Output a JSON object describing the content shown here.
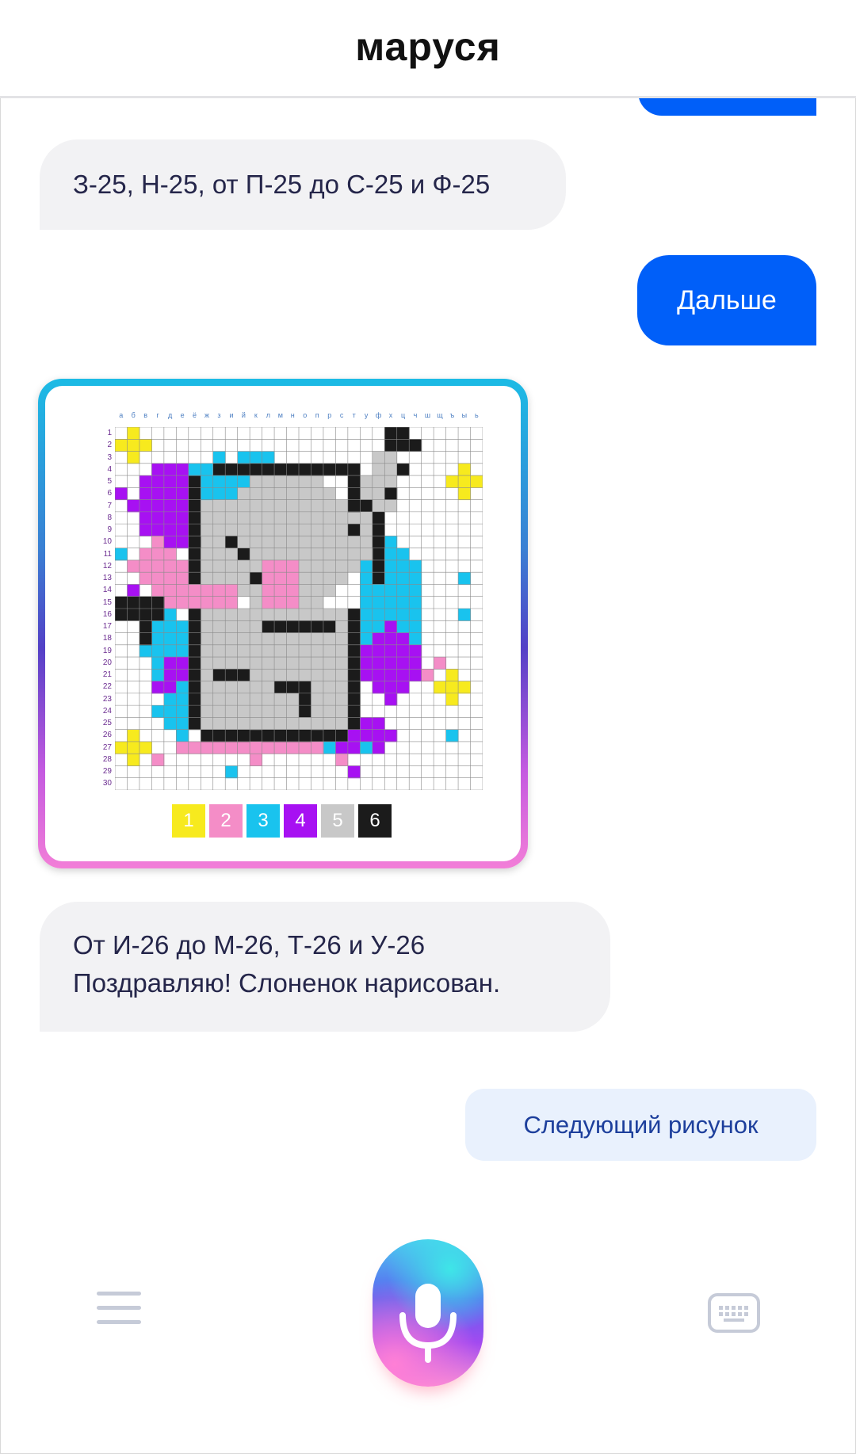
{
  "header": {
    "title": "маруся"
  },
  "chat": {
    "messages": [
      {
        "side": "assistant",
        "text": "З-25, Н-25, от П-25 до С-25 и Ф-25"
      },
      {
        "side": "user",
        "text": "Дальше"
      },
      {
        "side": "assistant",
        "lines": [
          "От И-26 до М-26, Т-26 и У-26",
          "Поздравляю! Слоненок нарисован."
        ]
      }
    ],
    "image_card": {
      "column_letters": [
        "а",
        "б",
        "в",
        "г",
        "д",
        "е",
        "ё",
        "ж",
        "з",
        "и",
        "й",
        "к",
        "л",
        "м",
        "н",
        "о",
        "п",
        "р",
        "с",
        "т",
        "у",
        "ф",
        "х",
        "ц",
        "ч",
        "ш",
        "щ",
        "ъ",
        "ы",
        "ь"
      ],
      "row_numbers": [
        "1",
        "2",
        "3",
        "4",
        "5",
        "6",
        "7",
        "8",
        "9",
        "10",
        "11",
        "12",
        "13",
        "14",
        "15",
        "16",
        "17",
        "18",
        "19",
        "20",
        "21",
        "22",
        "23",
        "24",
        "25",
        "26",
        "27",
        "28",
        "29",
        "30"
      ],
      "palette": [
        {
          "label": "1",
          "color": "#f7ea1e"
        },
        {
          "label": "2",
          "color": "#f48dc7"
        },
        {
          "label": "3",
          "color": "#19c3ee"
        },
        {
          "label": "4",
          "color": "#a711f2"
        },
        {
          "label": "5",
          "color": "#c8c8c8"
        },
        {
          "label": "6",
          "color": "#1b1b1b"
        }
      ]
    },
    "suggestion": "Следующий рисунок"
  },
  "toolbar": {
    "left": "menu-icon",
    "center": "microphone-icon",
    "right": "keyboard-icon"
  },
  "colors": {
    "user_bubble": "#005ff9",
    "assistant_bubble": "#f2f2f4",
    "assistant_text": "#25264a",
    "suggestion_bg": "#e9f1fd",
    "suggestion_text": "#1d3f9c"
  }
}
